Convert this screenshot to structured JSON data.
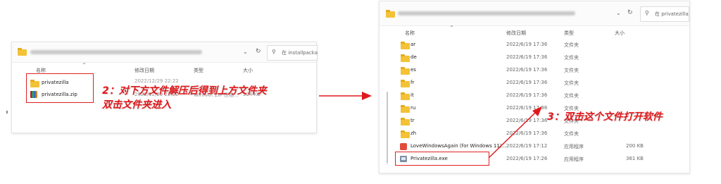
{
  "left_window": {
    "search_placeholder": "在 installpacka",
    "columns": {
      "name": "名称",
      "date": "修改日期",
      "type": "类型",
      "size": "大小"
    },
    "rows": [
      {
        "name": "privatezilla",
        "date": "2022/12/29 22:22",
        "type": "",
        "size": ""
      },
      {
        "name": "privatezilla.zip",
        "date": "2022/12/29 22:22",
        "type": "WinRAR ZIP 压缩...",
        "size": "224 KB"
      }
    ]
  },
  "right_window": {
    "search_placeholder": "在 privatezilla",
    "columns": {
      "name": "名称",
      "date": "修改日期",
      "type": "类型",
      "size": "大小"
    },
    "rows": [
      {
        "name": "ar",
        "date": "2022/6/19 17:36",
        "type": "文件夹",
        "size": "",
        "icon": "folder-icon"
      },
      {
        "name": "de",
        "date": "2022/6/19 17:36",
        "type": "文件夹",
        "size": "",
        "icon": "folder-icon"
      },
      {
        "name": "es",
        "date": "2022/6/19 17:36",
        "type": "文件夹",
        "size": "",
        "icon": "folder-icon"
      },
      {
        "name": "fr",
        "date": "2022/6/19 17:36",
        "type": "文件夹",
        "size": "",
        "icon": "folder-icon"
      },
      {
        "name": "it",
        "date": "2022/6/19 17:36",
        "type": "文件夹",
        "size": "",
        "icon": "folder-icon"
      },
      {
        "name": "ru",
        "date": "2022/6/19 17:36",
        "type": "文件夹",
        "size": "",
        "icon": "folder-icon"
      },
      {
        "name": "tr",
        "date": "2022/6/19 17:36",
        "type": "文件夹",
        "size": "",
        "icon": "folder-icon"
      },
      {
        "name": "zh",
        "date": "2022/6/19 17:36",
        "type": "文件夹",
        "size": "",
        "icon": "folder-icon"
      },
      {
        "name": "LoveWindowsAgain (for Windows 11)...",
        "date": "2022/6/19 17:12",
        "type": "应用程序",
        "size": "200 KB",
        "icon": "app-icon"
      },
      {
        "name": "Privatezilla.exe",
        "date": "2022/6/19 17:26",
        "type": "应用程序",
        "size": "361 KB",
        "icon": "exe-icon"
      }
    ]
  },
  "annotations": {
    "step2_line1": "2：对下方文件解压后得到上方文件夹",
    "step2_line2": "双击文件夹进入",
    "step3": "3：双击这个文件打开软件"
  },
  "colors": {
    "annotation_red": "#e0191c",
    "folder_yellow": "#f3c236"
  }
}
